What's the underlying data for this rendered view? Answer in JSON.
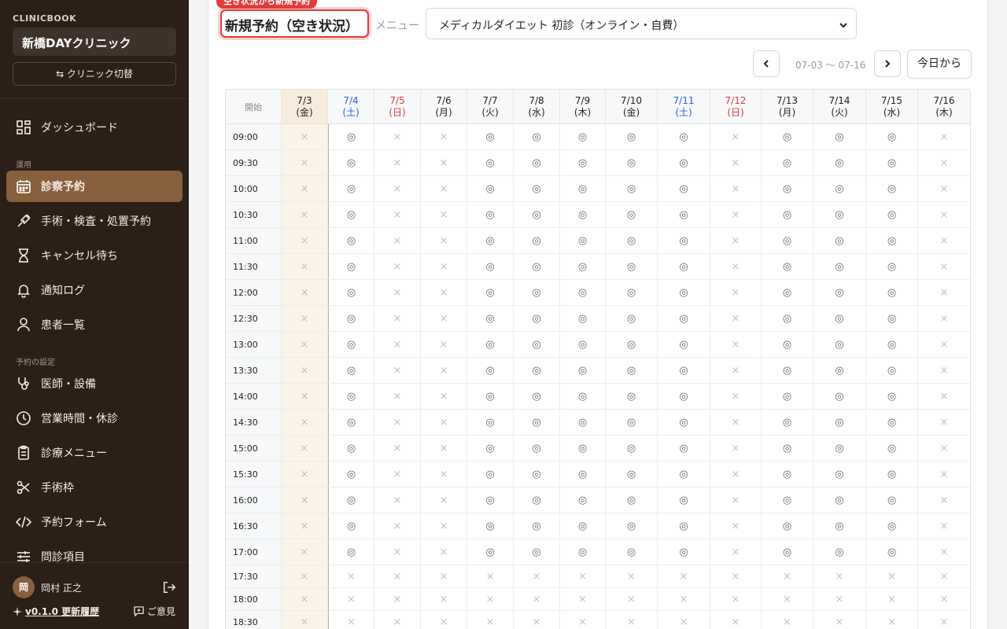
{
  "sidebar": {
    "brand": "CLINICBOOK",
    "clinic_name": "新橋DAYクリニック",
    "switch_label": "⇆ クリニック切替",
    "items": [
      {
        "label": "ダッシュボード",
        "icon": "dashboard-icon"
      },
      {
        "label": "診察予約",
        "icon": "calendar-icon",
        "active": true
      },
      {
        "label": "手術・検査・処置予約",
        "icon": "syringe-icon"
      },
      {
        "label": "キャンセル待ち",
        "icon": "hourglass-icon"
      },
      {
        "label": "通知ログ",
        "icon": "bell-icon"
      },
      {
        "label": "患者一覧",
        "icon": "user-icon"
      },
      {
        "label": "医師・設備",
        "icon": "stethoscope-icon"
      },
      {
        "label": "営業時間・休診",
        "icon": "clock-icon"
      },
      {
        "label": "診療メニュー",
        "icon": "clipboard-icon"
      },
      {
        "label": "手術枠",
        "icon": "scissors-icon"
      },
      {
        "label": "予約フォーム",
        "icon": "code-icon"
      },
      {
        "label": "問診項目",
        "icon": "sliders-icon"
      }
    ],
    "sections": {
      "operation": "運用",
      "settings": "予約の設定"
    },
    "user": {
      "avatar": "岡",
      "name": "岡村 正之"
    },
    "version": "v0.1.0 更新履歴",
    "feedback": "ご意見"
  },
  "main": {
    "tag": "空き状況から新規予約",
    "title": "新規予約（空き状況）",
    "menu_label": "メニュー",
    "menu_value": "メディカルダイエット 初診（オンライン・自費）",
    "range": "07-03 〜 07-16",
    "today_label": "今日から"
  },
  "schedule": {
    "corner": "開始",
    "days": [
      {
        "date": "7/3",
        "dow": "(金)",
        "kind": "selected"
      },
      {
        "date": "7/4",
        "dow": "(土)",
        "kind": "sat"
      },
      {
        "date": "7/5",
        "dow": "(日)",
        "kind": "sun"
      },
      {
        "date": "7/6",
        "dow": "(月)",
        "kind": "weekday"
      },
      {
        "date": "7/7",
        "dow": "(火)",
        "kind": "weekday"
      },
      {
        "date": "7/8",
        "dow": "(水)",
        "kind": "weekday"
      },
      {
        "date": "7/9",
        "dow": "(木)",
        "kind": "weekday"
      },
      {
        "date": "7/10",
        "dow": "(金)",
        "kind": "weekday"
      },
      {
        "date": "7/11",
        "dow": "(土)",
        "kind": "sat"
      },
      {
        "date": "7/12",
        "dow": "(日)",
        "kind": "sun"
      },
      {
        "date": "7/13",
        "dow": "(月)",
        "kind": "weekday"
      },
      {
        "date": "7/14",
        "dow": "(火)",
        "kind": "weekday"
      },
      {
        "date": "7/15",
        "dow": "(水)",
        "kind": "weekday"
      },
      {
        "date": "7/16",
        "dow": "(木)",
        "kind": "weekday"
      }
    ],
    "times": [
      "09:00",
      "09:30",
      "10:00",
      "10:30",
      "11:00",
      "11:30",
      "12:00",
      "12:30",
      "13:00",
      "13:30",
      "14:00",
      "14:30",
      "15:00",
      "15:30",
      "16:00",
      "16:30",
      "17:00",
      "17:30",
      "18:00",
      "18:30"
    ],
    "available_symbol": "◎",
    "unavailable_symbol": "×",
    "availability_pattern": "0100111110111",
    "closed_from_time": "17:30",
    "colors": {
      "accent": "#87603d",
      "sat": "#2962d9",
      "sun": "#e23b3b",
      "selected_col": "#faf3e8"
    }
  }
}
